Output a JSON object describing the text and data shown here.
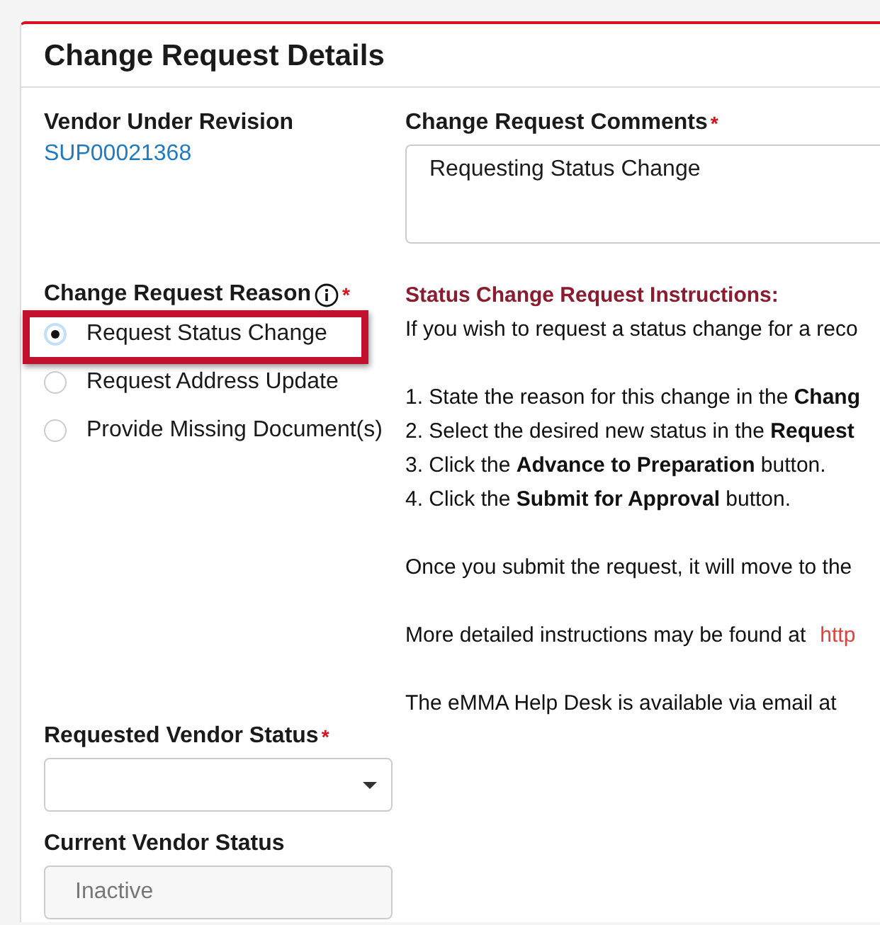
{
  "panel": {
    "title": "Change Request Details"
  },
  "vendor": {
    "label": "Vendor Under Revision",
    "value": "SUP00021368"
  },
  "comments": {
    "label": "Change Request Comments",
    "required_mark": "*",
    "value": "Requesting Status Change"
  },
  "reason": {
    "label": "Change Request Reason",
    "required_mark": "*",
    "options": [
      {
        "label": "Request Status Change",
        "selected": true,
        "highlighted": true
      },
      {
        "label": "Request Address Update",
        "selected": false,
        "highlighted": false
      },
      {
        "label": "Provide Missing Document(s)",
        "selected": false,
        "highlighted": false
      }
    ]
  },
  "instructions": {
    "heading": "Status Change Request Instructions:",
    "blocks": [
      {
        "kind": "para",
        "text": "If you wish to request a status change for a reco"
      },
      {
        "kind": "steps",
        "items": [
          "1. State the reason for this change in the **Chang**",
          "2. Select the desired new status in the **Request**",
          "3. Click the **Advance to Preparation** button.",
          "4. Click the **Submit for Approval** button."
        ]
      },
      {
        "kind": "para",
        "text": "Once you submit the request, it will move to the"
      },
      {
        "kind": "para",
        "text": "More detailed instructions may be found at",
        "link": "http"
      },
      {
        "kind": "para",
        "text": "The eMMA Help Desk is available via email at"
      }
    ]
  },
  "requested_status": {
    "label": "Requested Vendor Status",
    "required_mark": "*"
  },
  "current_status": {
    "label": "Current Vendor Status",
    "value": "Inactive",
    "disabled": true
  }
}
